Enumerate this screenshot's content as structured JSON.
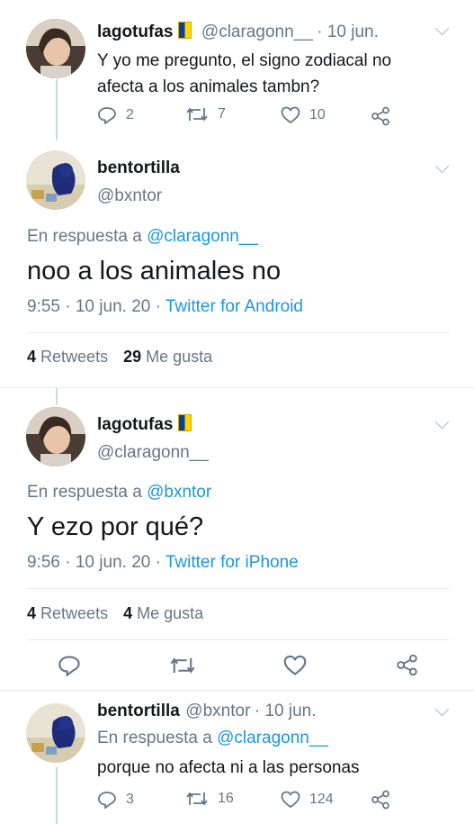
{
  "tweet1": {
    "name": "lagotufas",
    "handle": "@claragonn__",
    "date": "· 10 jun.",
    "text_line1": "Y yo me pregunto, el signo zodiacal no",
    "text_line2": "afecta a los animales tambn?",
    "replies": "2",
    "retweets": "7",
    "likes": "10"
  },
  "tweet2": {
    "name": "bentortilla",
    "handle": "@bxntor",
    "reply_prefix": "En respuesta a",
    "reply_to": "@claragonn__",
    "text": "noo a los animales no",
    "time": "9:55 · 10 jun. 20 ·",
    "source": "Twitter for Android",
    "retweets_count": "4",
    "retweets_label": "Retweets",
    "likes_count": "29",
    "likes_label": "Me gusta"
  },
  "tweet3": {
    "name": "lagotufas",
    "handle": "@claragonn__",
    "reply_prefix": "En respuesta a",
    "reply_to": "@bxntor",
    "text": "Y ezo por qué?",
    "time": "9:56 · 10 jun. 20 ·",
    "source": "Twitter for iPhone",
    "retweets_count": "4",
    "retweets_label": "Retweets",
    "likes_count": "4",
    "likes_label": "Me gusta"
  },
  "tweet4": {
    "name": "bentortilla",
    "handle": "@bxntor",
    "date": "· 10 jun.",
    "reply_prefix": "En respuesta a",
    "reply_to": "@claragonn__",
    "text": "porque no afecta ni a las personas",
    "replies": "3",
    "retweets": "16",
    "likes": "124"
  },
  "colors": {
    "link": "#1b95e0",
    "muted": "#657786",
    "divider": "#e6ecf0"
  }
}
